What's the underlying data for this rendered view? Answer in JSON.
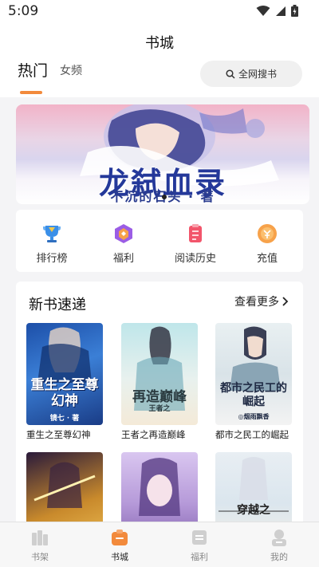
{
  "status_bar": {
    "time": "5:09"
  },
  "header": {
    "title": "书城"
  },
  "tabs": [
    {
      "label": "热门",
      "active": true
    },
    {
      "label": "女频",
      "active": false
    }
  ],
  "search": {
    "label": "全网搜书"
  },
  "banner": {
    "title": "龙弑血录",
    "subtitle": "不沉的石头 · 著"
  },
  "quick_links": [
    {
      "label": "排行榜",
      "icon": "trophy-icon"
    },
    {
      "label": "福利",
      "icon": "gift-icon"
    },
    {
      "label": "阅读历史",
      "icon": "history-icon"
    },
    {
      "label": "充值",
      "icon": "coin-icon"
    }
  ],
  "new_books": {
    "title": "新书速递",
    "more_label": "查看更多",
    "books": [
      {
        "title": "重生之至尊幻神",
        "cover_text": "重生之至尊幻神",
        "cover_author": "镜七 · 著"
      },
      {
        "title": "王者之再造巅峰",
        "cover_text": "再造巅峰",
        "cover_author": "王者之"
      },
      {
        "title": "都市之民工的崛起",
        "cover_text": "都市之民工的崛起",
        "cover_author": "◎烟雨飘香"
      },
      {
        "title": "",
        "cover_text": "",
        "cover_author": ""
      },
      {
        "title": "",
        "cover_text": "",
        "cover_author": ""
      },
      {
        "title": "",
        "cover_text": "穿越之",
        "cover_author": ""
      }
    ]
  },
  "bottom_nav": [
    {
      "label": "书架",
      "icon": "bookshelf-icon",
      "active": false
    },
    {
      "label": "书城",
      "icon": "bookstore-icon",
      "active": true
    },
    {
      "label": "福利",
      "icon": "benefits-icon",
      "active": false
    },
    {
      "label": "我的",
      "icon": "profile-icon",
      "active": false
    }
  ],
  "colors": {
    "accent": "#f28a3c",
    "background": "#f4f4f6"
  }
}
